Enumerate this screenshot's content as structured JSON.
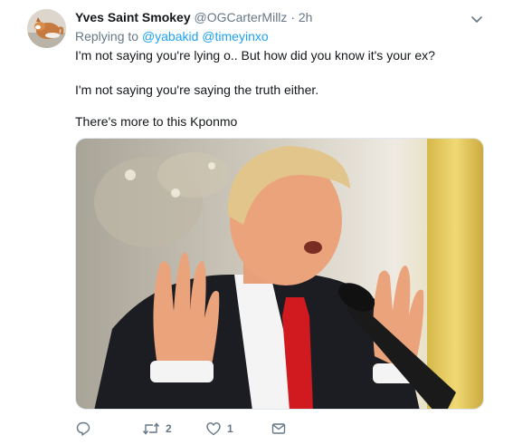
{
  "tweet": {
    "display_name": "Yves Saint Smokey",
    "handle": "@OGCarterMillz",
    "separator": "·",
    "time": "2h",
    "replying_to_label": "Replying to",
    "mentions": [
      "@yabakid",
      "@timeyinxo"
    ],
    "lines": [
      "I'm not saying you're lying o.. But how did you know it's your ex?",
      "I'm not saying you're saying the truth either.",
      "There's more to this Kponmo"
    ],
    "media_description_icon": "photo",
    "actions": {
      "reply_count": "",
      "retweet_count": "2",
      "like_count": "1"
    }
  },
  "colors": {
    "link": "#1da1f2",
    "muted": "#657786",
    "text": "#14171a",
    "tie_red": "#d11a1f",
    "curtain_gold": "#e8c65a"
  },
  "icons": {
    "caret": "chevron-down-icon",
    "reply": "reply-icon",
    "retweet": "retweet-icon",
    "like": "heart-icon",
    "message": "envelope-icon"
  }
}
